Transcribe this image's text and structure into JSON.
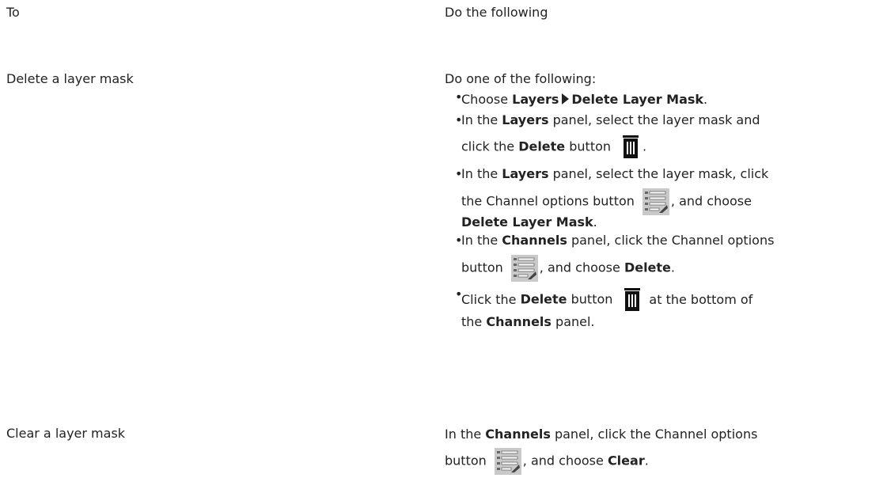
{
  "header": {
    "col1": "To",
    "col2": "Do the following"
  },
  "rows": [
    {
      "task": "Delete a layer mask",
      "intro": "Do one of the following:",
      "bullets": [
        {
          "t1": "Choose",
          "b1": "Layers",
          "b2": "Delete Layer Mask",
          "t2": "."
        },
        {
          "t1": "In the",
          "b1": "Layers",
          "t2": "panel, select the layer mask and",
          "t3": "click the",
          "b2": "Delete",
          "t4": "button",
          "t5": "."
        },
        {
          "t1": "In the",
          "b1": "Layers",
          "t2": "panel, select the layer mask, click",
          "t3": "the Channel options button",
          "t4": ", and choose",
          "b2": "Delete Layer Mask",
          "t5": "."
        },
        {
          "t1": "In the",
          "b1": "Channels",
          "t2": "panel, click the Channel options",
          "t3": "button",
          "t4": ", and choose",
          "b2": "Delete",
          "t5": "."
        },
        {
          "t1": "Click the",
          "b1": "Delete",
          "t2": "button",
          "t3": "at the bottom of",
          "t4": "the",
          "b2": "Channels",
          "t5": "panel."
        }
      ]
    },
    {
      "task": "Clear a layer mask",
      "l1a": "In the",
      "l1b": "Channels",
      "l1c": "panel, click the Channel options",
      "l2a": "button",
      "l2b": ", and choose",
      "l2c": "Clear",
      "l2d": "."
    }
  ],
  "icons": {
    "trash": "trash-icon",
    "channel_options": "channel-options-icon",
    "arrow": "menu-arrow-icon"
  },
  "colors": {
    "text": "#222222",
    "icon_bg": "#c9c9c9"
  }
}
